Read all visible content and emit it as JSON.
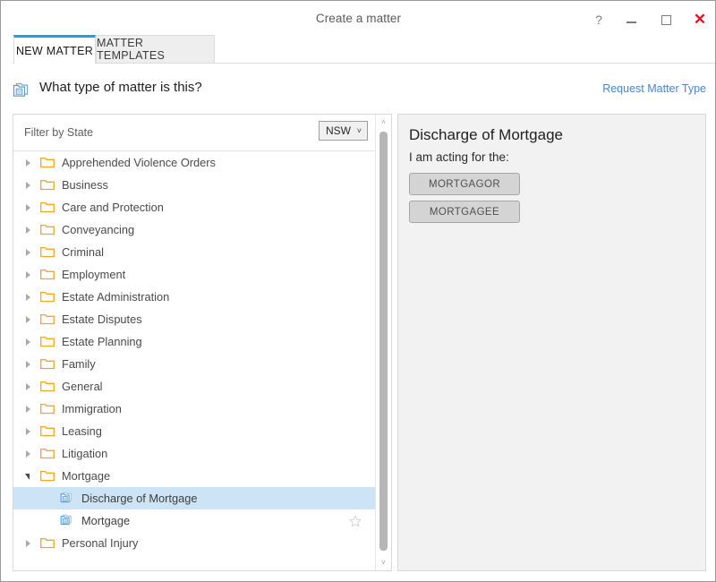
{
  "window": {
    "title": "Create a matter",
    "controls": [
      {
        "name": "help-button",
        "glyph": "?"
      },
      {
        "name": "minimize-button",
        "glyph": ""
      },
      {
        "name": "maximize-button",
        "glyph": ""
      },
      {
        "name": "close-button",
        "glyph": "✕"
      }
    ]
  },
  "tabs": [
    {
      "label": "NEW MATTER",
      "active": true
    },
    {
      "label": "MATTER TEMPLATES",
      "active": false
    }
  ],
  "header": {
    "icon": "matter-type-icon",
    "question": "What type of matter is this?",
    "request_link": "Request Matter Type"
  },
  "filter": {
    "label": "Filter by State",
    "state_value": "NSW",
    "chevron": "˅"
  },
  "tree": {
    "items": [
      {
        "label": "Apprehended Violence Orders",
        "type": "category",
        "expanded": false
      },
      {
        "label": "Business",
        "type": "category",
        "expanded": false
      },
      {
        "label": "Care and Protection",
        "type": "category",
        "expanded": false
      },
      {
        "label": "Conveyancing",
        "type": "category",
        "expanded": false
      },
      {
        "label": "Criminal",
        "type": "category",
        "expanded": false
      },
      {
        "label": "Employment",
        "type": "category",
        "expanded": false
      },
      {
        "label": "Estate Administration",
        "type": "category",
        "expanded": false
      },
      {
        "label": "Estate Disputes",
        "type": "category",
        "expanded": false
      },
      {
        "label": "Estate Planning",
        "type": "category",
        "expanded": false
      },
      {
        "label": "Family",
        "type": "category",
        "expanded": false
      },
      {
        "label": "General",
        "type": "category",
        "expanded": false
      },
      {
        "label": "Immigration",
        "type": "category",
        "expanded": false
      },
      {
        "label": "Leasing",
        "type": "category",
        "expanded": false
      },
      {
        "label": "Litigation",
        "type": "category",
        "expanded": false
      },
      {
        "label": "Mortgage",
        "type": "category",
        "expanded": true
      },
      {
        "label": "Discharge of Mortgage",
        "type": "leaf",
        "selected": true,
        "starred": false
      },
      {
        "label": "Mortgage",
        "type": "leaf",
        "selected": false,
        "starred": true
      },
      {
        "label": "Personal Injury",
        "type": "category",
        "expanded": false
      }
    ]
  },
  "detail": {
    "title": "Discharge of Mortgage",
    "subtitle": "I am acting for the:",
    "buttons": [
      {
        "label": "MORTGAGOR"
      },
      {
        "label": "MORTGAGEE"
      }
    ]
  },
  "colors": {
    "accent": "#1ba1e2",
    "link": "#4a86c8",
    "folder": "#f5a623",
    "selection": "#cce4f6",
    "close": "#e81123",
    "panel_bg": "#f2f2f2"
  },
  "scrollbar": {
    "up_glyph": "˄",
    "down_glyph": "˅"
  }
}
